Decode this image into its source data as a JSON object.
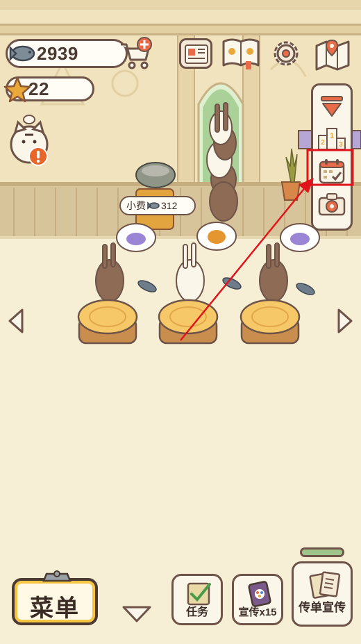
{
  "hud": {
    "fish_count": "2939",
    "star_count": "22"
  },
  "tip": {
    "label": "小费",
    "amount": "312"
  },
  "bottom_bar": {
    "menu_label": "菜单",
    "tasks_label": "任务",
    "promo_label": "宣传x15",
    "flyer_label": "传单宣传"
  },
  "icons": {
    "fish": "fish-icon",
    "cart": "shop-cart-plus-icon",
    "star": "star-icon",
    "news": "newspaper-icon",
    "book": "recipe-book-icon",
    "settings": "gear-icon",
    "map": "map-icon",
    "collapse": "collapse-triangle-icon",
    "ranking": "podium-ranking-icon",
    "calendar": "calendar-check-icon",
    "camera": "camera-icon",
    "left": "arrow-left-icon",
    "right": "arrow-right-icon",
    "down": "chevron-down-icon"
  },
  "colors": {
    "outline": "#6e5448",
    "highlight_box": "#e0141a",
    "alert": "#e8662a",
    "menu_accent": "#f5c443",
    "progress": "#8fc97a"
  },
  "progress": {
    "fill": 0.0
  }
}
